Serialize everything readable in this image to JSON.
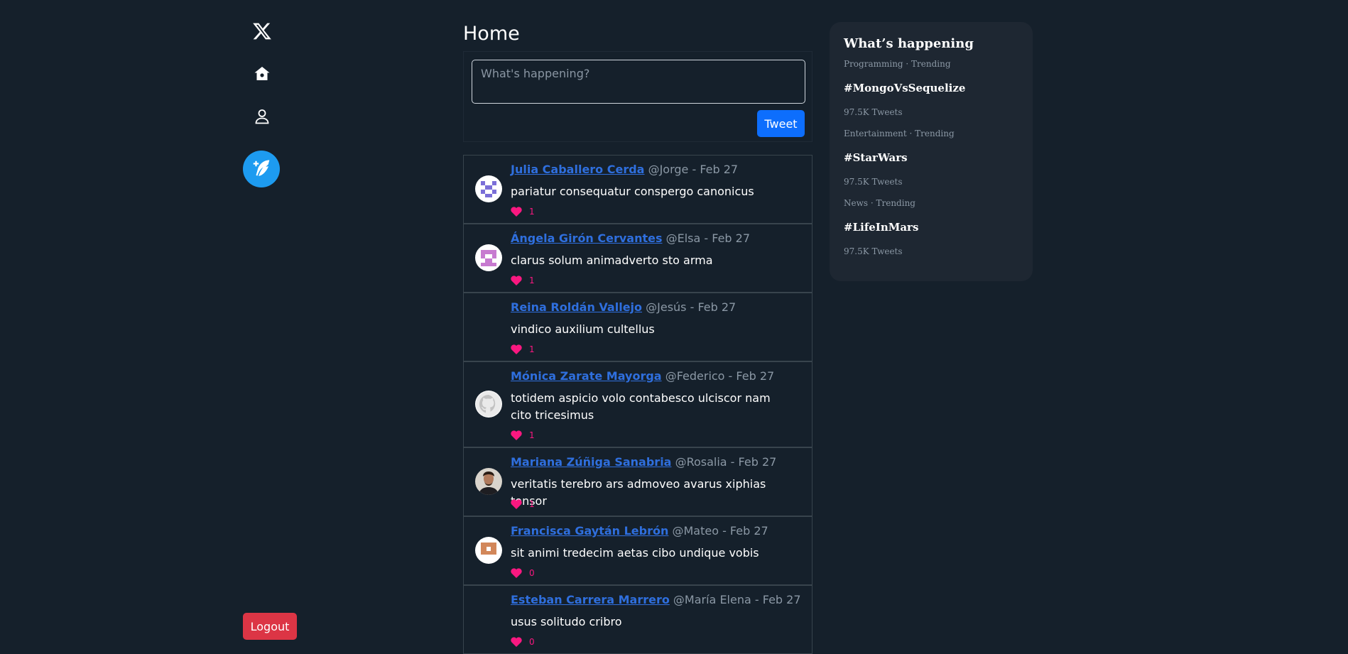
{
  "sidebar": {
    "logo_icon": "x-logo-icon",
    "items": [
      {
        "icon": "home-icon"
      },
      {
        "icon": "profile-icon"
      }
    ],
    "compose_icon": "feather-plus-icon",
    "logout_label": "Logout"
  },
  "main": {
    "title": "Home",
    "composer": {
      "placeholder": "What's happening?",
      "tweet_label": "Tweet"
    },
    "tweets": [
      {
        "author": "Julia Caballero Cerda",
        "meta": "@Jorge - Feb 27",
        "text": "pariatur consequatur conspergo canonicus",
        "likes": "1",
        "avatar": "identicon-purple"
      },
      {
        "author": "Ángela Girón Cervantes",
        "meta": "@Elsa - Feb 27",
        "text": "clarus solum animadverto sto arma",
        "likes": "1",
        "avatar": "identicon-pink"
      },
      {
        "author": "Reina Roldán Vallejo",
        "meta": "@Jesús - Feb 27",
        "text": "vindico auxilium cultellus",
        "likes": "1",
        "avatar": "none"
      },
      {
        "author": "Mónica Zarate Mayorga",
        "meta": "@Federico - Feb 27",
        "text": "totidem aspicio volo contabesco ulciscor nam cito tricesimus",
        "likes": "1",
        "avatar": "github-octocat"
      },
      {
        "author": "Mariana Zúñiga Sanabria",
        "meta": "@Rosalia - Feb 27",
        "text": "veritatis terebro ars admoveo avarus xiphias tonsor",
        "likes": "1",
        "avatar": "photo-person"
      },
      {
        "author": "Francisca Gaytán Lebrón",
        "meta": "@Mateo - Feb 27",
        "text": "sit animi tredecim aetas cibo undique vobis",
        "likes": "0",
        "avatar": "identicon-orange"
      },
      {
        "author": "Esteban Carrera Marrero",
        "meta": "@María Elena - Feb 27",
        "text": "usus solitudo cribro",
        "likes": "0",
        "avatar": "none"
      }
    ]
  },
  "trends": {
    "title": "What’s happening",
    "items": [
      {
        "category": "Programming · Trending",
        "tag": "#MongoVsSequelize",
        "count": "97.5K Tweets"
      },
      {
        "category": "Entertainment · Trending",
        "tag": "#StarWars",
        "count": "97.5K Tweets"
      },
      {
        "category": "News · Trending",
        "tag": "#LifeInMars",
        "count": "97.5K Tweets"
      }
    ]
  },
  "colors": {
    "background": "#15202b",
    "accent": "#1d9bf0",
    "link": "#2f6fde",
    "like": "#f91880",
    "logout": "#dc3545",
    "tweet_button": "#0d6efd"
  }
}
